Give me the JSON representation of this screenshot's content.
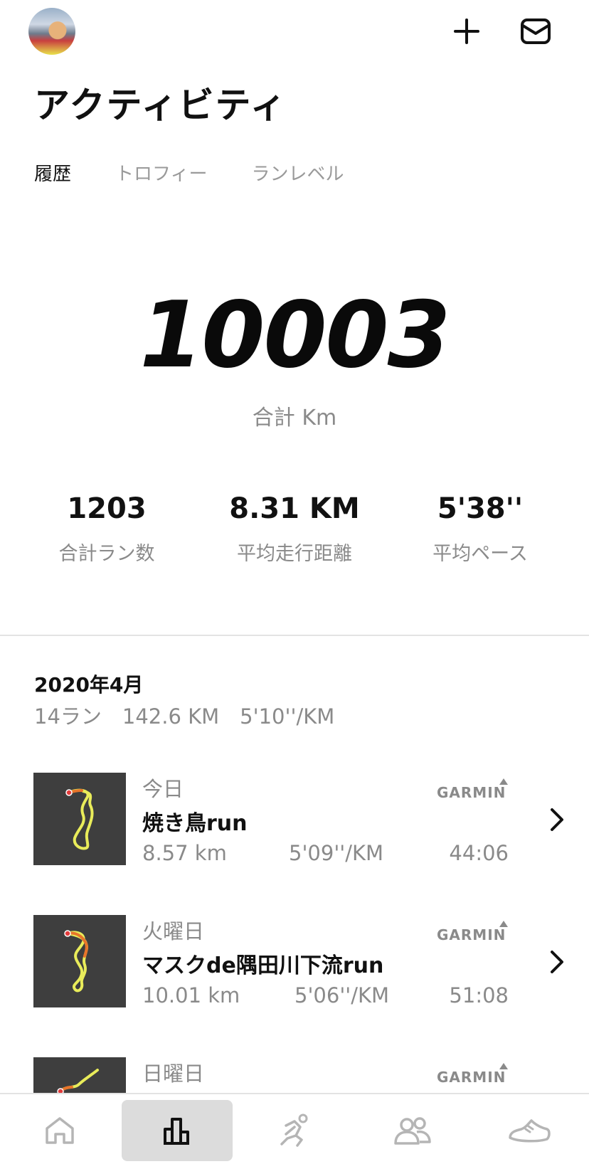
{
  "header": {
    "title": "アクティビティ",
    "add_icon": "plus-icon",
    "inbox_icon": "mail-icon"
  },
  "tabs": [
    {
      "label": "履歴",
      "active": true
    },
    {
      "label": "トロフィー",
      "active": false
    },
    {
      "label": "ランレベル",
      "active": false
    }
  ],
  "totals": {
    "distance": "10003",
    "distance_label": "合計 Km"
  },
  "stats": [
    {
      "value": "1203",
      "label": "合計ラン数"
    },
    {
      "value": "8.31 KM",
      "label": "平均走行距離"
    },
    {
      "value": "5'38''",
      "label": "平均ペース"
    }
  ],
  "month": {
    "title": "2020年4月",
    "summary": "14ラン　142.6 KM　5'10''/KM"
  },
  "runs": [
    {
      "day": "今日",
      "name": "焼き鳥run",
      "distance": "8.57 km",
      "pace": "5'09''/KM",
      "time": "44:06",
      "source": "GARMIN"
    },
    {
      "day": "火曜日",
      "name": "マスクde隅田川下流run",
      "distance": "10.01 km",
      "pace": "5'06''/KM",
      "time": "51:08",
      "source": "GARMIN"
    },
    {
      "day": "日曜日",
      "name": "",
      "distance": "",
      "pace": "",
      "time": "",
      "source": "GARMIN"
    }
  ],
  "bottom_nav": [
    {
      "icon": "home-icon",
      "active": false
    },
    {
      "icon": "activity-bar-chart-icon",
      "active": true
    },
    {
      "icon": "runner-icon",
      "active": false
    },
    {
      "icon": "club-people-icon",
      "active": false
    },
    {
      "icon": "shoe-icon",
      "active": false
    }
  ],
  "colors": {
    "text_primary": "#111111",
    "text_secondary": "#8a8a8a",
    "map_background": "#3e3e3e",
    "route_yellow": "#e9ec5a",
    "route_orange": "#e8742a",
    "nav_active_bg": "#dcdcdc"
  }
}
